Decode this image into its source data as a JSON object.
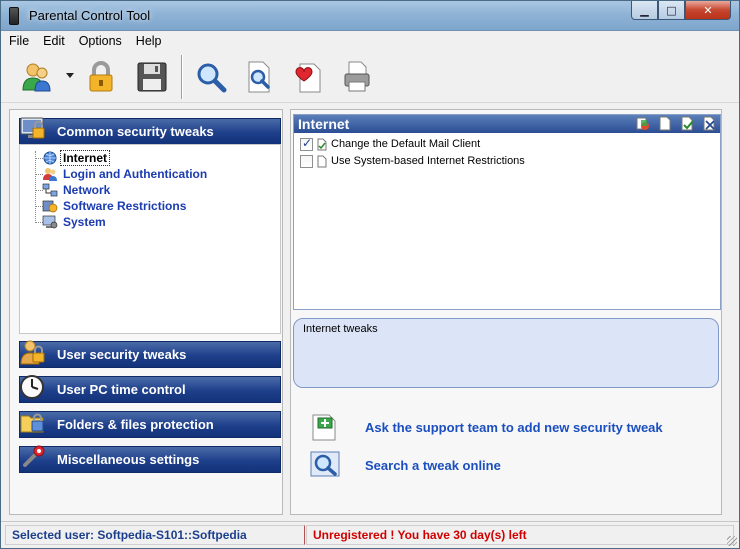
{
  "window": {
    "title": "Parental Control Tool",
    "controls": {
      "minimize": "▁",
      "maximize": "□",
      "close": "✕"
    }
  },
  "menu": [
    "File",
    "Edit",
    "Options",
    "Help"
  ],
  "toolbar": {
    "icons": [
      "users-icon",
      "lock-icon",
      "save-icon",
      "search-icon",
      "search-document-icon",
      "favorite-document-icon",
      "print-icon"
    ]
  },
  "sidebar": {
    "categories": [
      {
        "label": "Common security tweaks",
        "icon": "monitor-lock-icon"
      },
      {
        "label": "User security tweaks",
        "icon": "user-lock-icon"
      },
      {
        "label": "User PC time control",
        "icon": "clock-icon"
      },
      {
        "label": "Folders & files protection",
        "icon": "folder-lock-icon"
      },
      {
        "label": "Miscellaneous settings",
        "icon": "wrench-icon"
      }
    ],
    "tree": [
      {
        "label": "Internet",
        "icon": "globe-icon",
        "selected": true
      },
      {
        "label": "Login and Authentication",
        "icon": "users-icon"
      },
      {
        "label": "Network",
        "icon": "network-icon"
      },
      {
        "label": "Software Restrictions",
        "icon": "software-icon"
      },
      {
        "label": "System",
        "icon": "system-icon"
      }
    ]
  },
  "main": {
    "list_title": "Internet",
    "items": [
      {
        "label": "Change the Default Mail Client",
        "checked": true
      },
      {
        "label": "Use System-based Internet Restrictions",
        "checked": false
      }
    ],
    "description": "Internet tweaks",
    "actions": [
      {
        "label": "Ask the support team to add new security tweak",
        "icon": "add-document-icon"
      },
      {
        "label": "Search a tweak online",
        "icon": "search-online-icon"
      }
    ]
  },
  "status": {
    "selected_user": "Selected user: Softpedia-S101::Softpedia",
    "registration": "Unregistered ! You have 30 day(s) left"
  },
  "colors": {
    "header_blue": "#1e3f8a",
    "link_blue": "#1b4fbf",
    "warning_red": "#d10000"
  }
}
